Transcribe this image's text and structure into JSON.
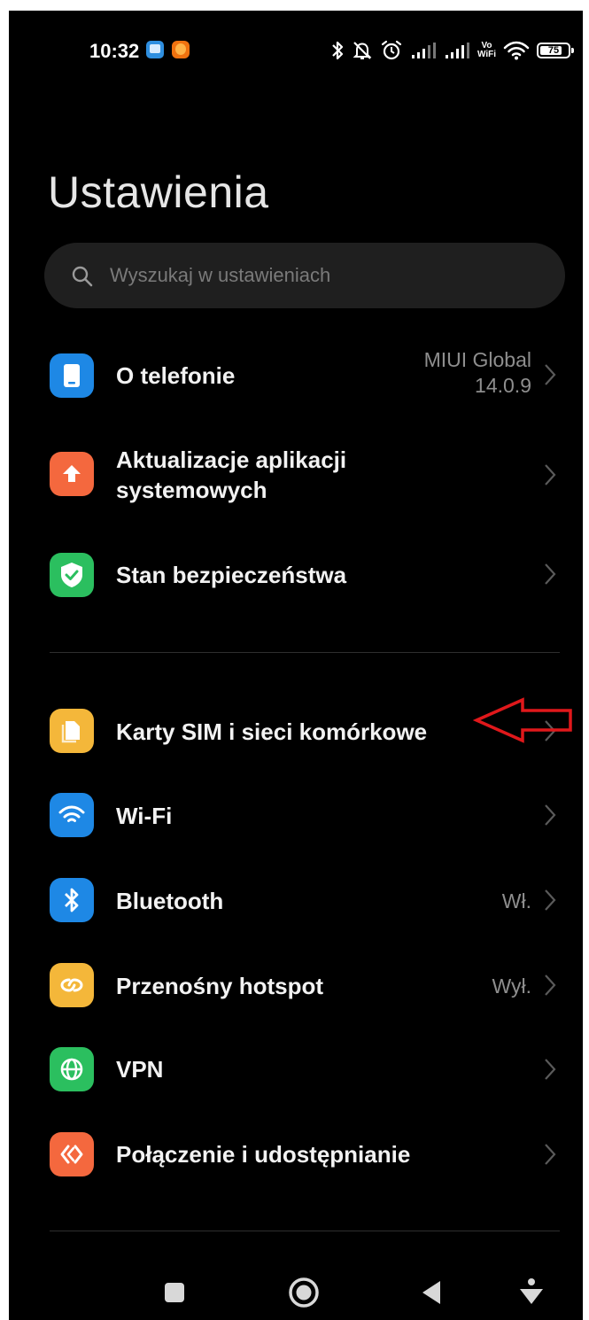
{
  "status_bar": {
    "time": "10:32",
    "vowifi_top": "Vo",
    "vowifi_bottom": "WiFi",
    "battery": "75"
  },
  "title": "Ustawienia",
  "search": {
    "placeholder": "Wyszukaj w ustawieniach"
  },
  "items": [
    {
      "label": "O telefonie",
      "value_line1": "MIUI Global",
      "value_line2": "14.0.9",
      "icon": "phone-icon",
      "color": "#1e88e5"
    },
    {
      "label_line1": "Aktualizacje aplikacji",
      "label_line2": "systemowych",
      "icon": "upload-arrow-icon",
      "color": "#f4683e"
    },
    {
      "label": "Stan bezpieczeństwa",
      "icon": "shield-check-icon",
      "color": "#2bbf5f"
    },
    {
      "label": "Karty SIM i sieci komórkowe",
      "icon": "sim-card-icon",
      "color": "#f4b73a"
    },
    {
      "label": "Wi-Fi",
      "icon": "wifi-icon",
      "color": "#1e88e5"
    },
    {
      "label": "Bluetooth",
      "value": "Wł.",
      "icon": "bluetooth-icon",
      "color": "#1e88e5"
    },
    {
      "label": "Przenośny hotspot",
      "value": "Wył.",
      "icon": "hotspot-icon",
      "color": "#f4b73a"
    },
    {
      "label": "VPN",
      "icon": "globe-icon",
      "color": "#2bbf5f"
    },
    {
      "label": "Połączenie i udostępnianie",
      "icon": "share-connection-icon",
      "color": "#f4683e"
    }
  ],
  "colors": {
    "background": "#000000",
    "search_bg": "#1f1f1f",
    "annotation_arrow": "#e0181b"
  }
}
